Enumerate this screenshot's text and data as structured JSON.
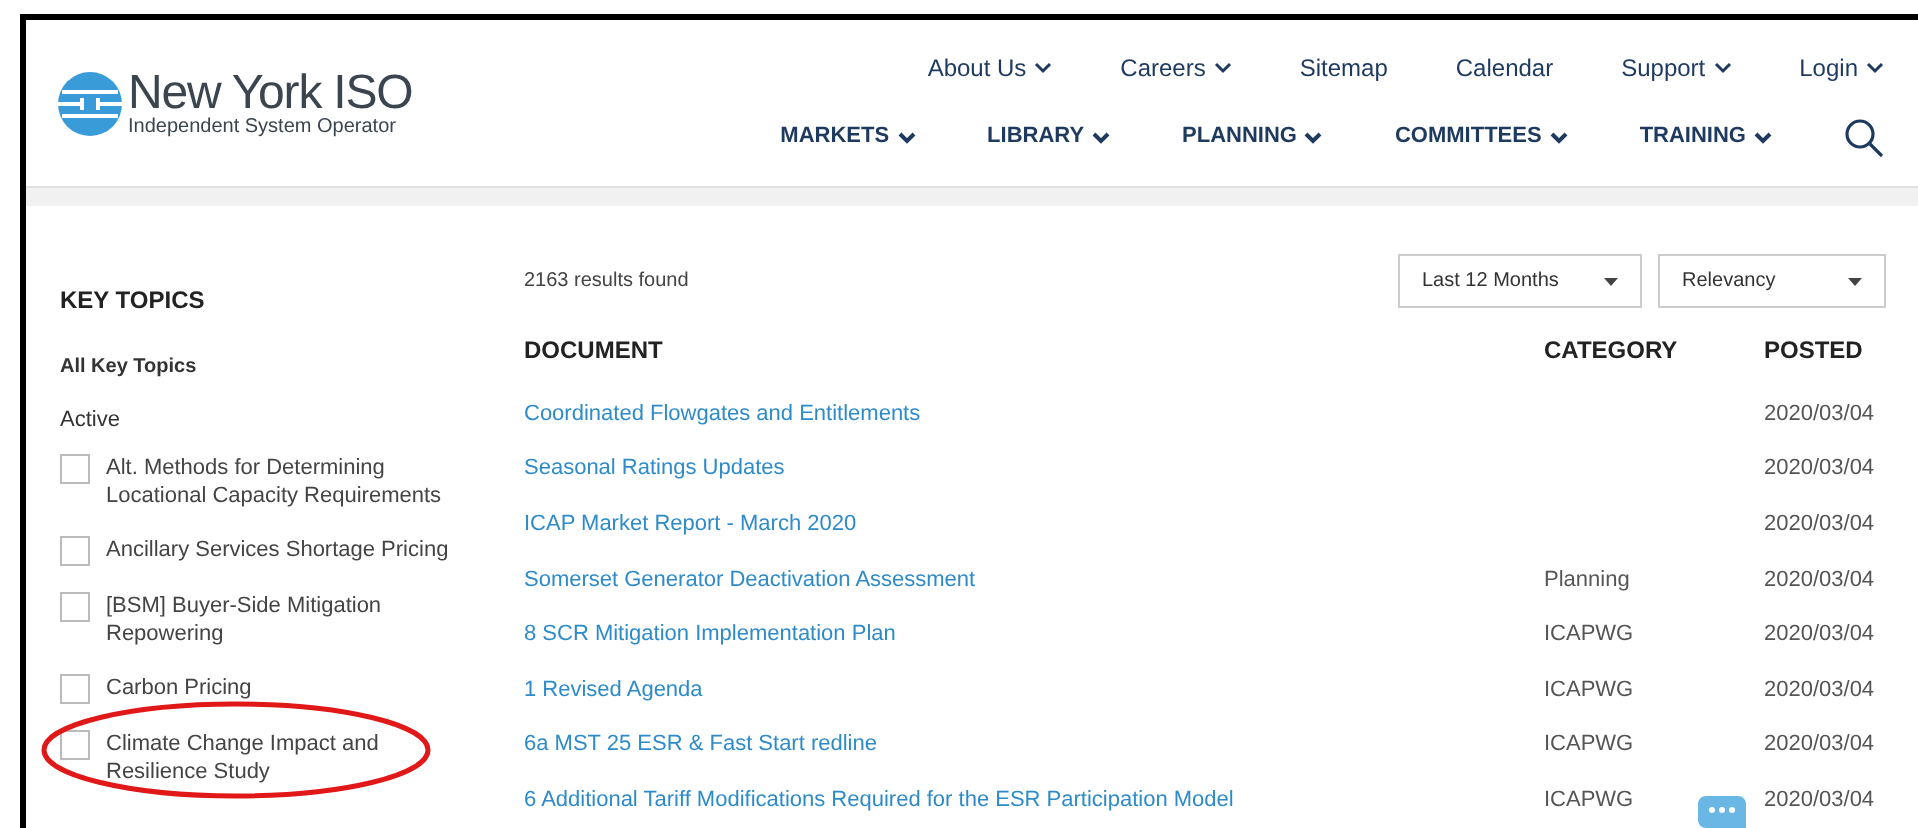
{
  "header": {
    "logo": {
      "name": "New York ISO",
      "tagline": "Independent System Operator"
    },
    "utility_nav": [
      {
        "label": "About Us",
        "dropdown": true
      },
      {
        "label": "Careers",
        "dropdown": true
      },
      {
        "label": "Sitemap",
        "dropdown": false
      },
      {
        "label": "Calendar",
        "dropdown": false
      },
      {
        "label": "Support",
        "dropdown": true
      },
      {
        "label": "Login",
        "dropdown": true
      }
    ],
    "main_nav": [
      {
        "label": "MARKETS",
        "dropdown": true
      },
      {
        "label": "LIBRARY",
        "dropdown": true
      },
      {
        "label": "PLANNING",
        "dropdown": true
      },
      {
        "label": "COMMITTEES",
        "dropdown": true
      },
      {
        "label": "TRAINING",
        "dropdown": true
      }
    ]
  },
  "sidebar": {
    "title": "KEY TOPICS",
    "all_link": "All Key Topics",
    "section_label": "Active",
    "topics": [
      {
        "label": "Alt. Methods for Determining Locational Capacity Requirements",
        "checked": false,
        "circled": false
      },
      {
        "label": "Ancillary Services Shortage Pricing",
        "checked": false,
        "circled": false
      },
      {
        "label": "[BSM] Buyer-Side Mitigation Repowering",
        "checked": false,
        "circled": false
      },
      {
        "label": "Carbon Pricing",
        "checked": false,
        "circled": false
      },
      {
        "label": "Climate Change Impact and Resilience Study",
        "checked": false,
        "circled": true
      }
    ]
  },
  "results": {
    "count": "2163 results found",
    "filters": [
      {
        "value": "Last 12 Months"
      },
      {
        "value": "Relevancy"
      }
    ],
    "columns": [
      "DOCUMENT",
      "CATEGORY",
      "POSTED"
    ],
    "rows": [
      {
        "document": "Coordinated Flowgates and Entitlements",
        "posted": "2020/03/04"
      },
      {
        "document": "Seasonal Ratings Updates",
        "posted": "2020/03/04"
      },
      {
        "document": "ICAP Market Report - March 2020",
        "posted": "2020/03/04"
      },
      {
        "document": "Somerset Generator Deactivation Assessment",
        "category": "Planning",
        "posted": "2020/03/04"
      },
      {
        "document": "8 SCR Mitigation Implementation Plan",
        "category": "ICAPWG",
        "posted": "2020/03/04"
      },
      {
        "document": "1 Revised Agenda",
        "category": "ICAPWG",
        "posted": "2020/03/04"
      },
      {
        "document": "6a MST 25 ESR & Fast Start redline",
        "category": "ICAPWG",
        "posted": "2020/03/04"
      },
      {
        "document": "6 Additional Tariff Modifications Required for the ESR Participation Model",
        "category": "ICAPWG",
        "posted": "2020/03/04"
      }
    ]
  }
}
